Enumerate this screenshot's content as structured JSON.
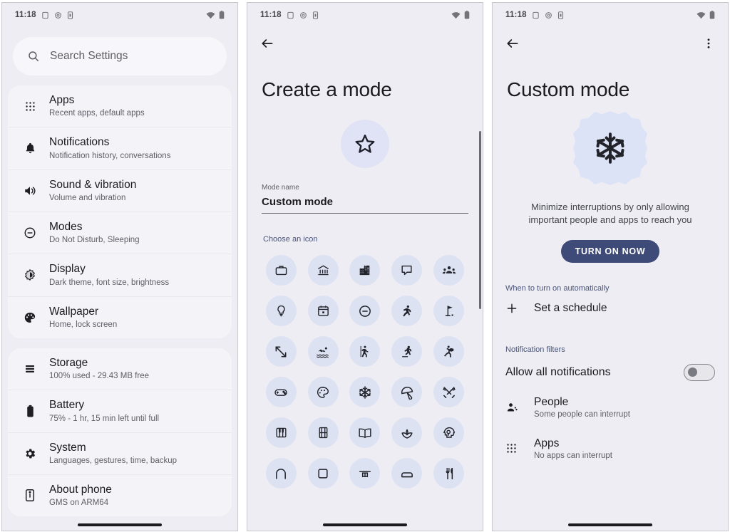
{
  "statusbar": {
    "time": "11:18",
    "left_icons": [
      "screenshot-icon",
      "gear-icon",
      "sim-card-icon"
    ],
    "right_icons": [
      "wifi-icon",
      "battery-icon"
    ]
  },
  "colors": {
    "screen_bg": "#eeedf3",
    "card_bg": "#f4f3f8",
    "search_bg": "#f7f6fa",
    "accent_chip": "#dde2f2",
    "accent_hero": "#dde3f6",
    "cta_bg": "#3e4a78",
    "section_label": "#4a5578",
    "primary_text": "#1b1b1f",
    "secondary_text": "#5e5e66"
  },
  "panel1": {
    "name": "settings-home",
    "search": {
      "placeholder": "Search Settings",
      "icon": "search-icon"
    },
    "groups": [
      {
        "items": [
          {
            "icon": "apps-grid-icon",
            "title": "Apps",
            "subtitle": "Recent apps, default apps"
          },
          {
            "icon": "bell-icon",
            "title": "Notifications",
            "subtitle": "Notification history, conversations"
          },
          {
            "icon": "volume-icon",
            "title": "Sound & vibration",
            "subtitle": "Volume and vibration"
          },
          {
            "icon": "do-not-disturb-icon",
            "title": "Modes",
            "subtitle": "Do Not Disturb, Sleeping"
          },
          {
            "icon": "brightness-icon",
            "title": "Display",
            "subtitle": "Dark theme, font size, brightness"
          },
          {
            "icon": "palette-icon",
            "title": "Wallpaper",
            "subtitle": "Home, lock screen"
          }
        ]
      },
      {
        "items": [
          {
            "icon": "storage-icon",
            "title": "Storage",
            "subtitle": "100% used - 29.43 MB free"
          },
          {
            "icon": "battery-icon",
            "title": "Battery",
            "subtitle": "75% - 1 hr, 15 min left until full"
          },
          {
            "icon": "gear-icon",
            "title": "System",
            "subtitle": "Languages, gestures, time, backup"
          },
          {
            "icon": "phone-info-icon",
            "title": "About phone",
            "subtitle": "GMS on ARM64"
          }
        ]
      }
    ]
  },
  "panel2": {
    "name": "create-a-mode",
    "back_icon": "back-arrow-icon",
    "title": "Create a mode",
    "badge_icon": "star-icon",
    "field": {
      "label": "Mode name",
      "value": "Custom mode"
    },
    "icon_picker": {
      "label": "Choose an icon",
      "icons": [
        "briefcase-icon",
        "bank-icon",
        "apartment-icon",
        "chat-bubble-icon",
        "groups-icon",
        "lightbulb-icon",
        "calendar-icon",
        "do-not-disturb-icon",
        "running-icon",
        "golf-icon",
        "arrows-diagonal-icon",
        "swimming-icon",
        "hiking-icon",
        "skating-icon",
        "martial-arts-icon",
        "gamepad-icon",
        "palette-icon",
        "snowflake-icon",
        "beach-umbrella-icon",
        "tools-icon",
        "piano-icon",
        "film-icon",
        "book-icon",
        "spa-icon",
        "psychology-icon",
        "arch-icon",
        "square-icon",
        "bench-icon",
        "bed-icon",
        "restaurant-icon"
      ]
    }
  },
  "panel3": {
    "name": "custom-mode-detail",
    "back_icon": "back-arrow-icon",
    "overflow_icon": "more-vert-icon",
    "title": "Custom mode",
    "hero_icon": "snowflake-icon",
    "description": "Minimize interruptions by only allowing important people and apps to reach you",
    "cta_label": "TURN ON NOW",
    "schedule_section": {
      "header": "When to turn on automatically",
      "add_icon": "plus-icon",
      "label": "Set a schedule"
    },
    "filters_section": {
      "header": "Notification filters",
      "toggle": {
        "label": "Allow all notifications",
        "state": "off"
      },
      "rows": [
        {
          "icon": "person-icon",
          "title": "People",
          "subtitle": "Some people can interrupt"
        },
        {
          "icon": "apps-grid-icon",
          "title": "Apps",
          "subtitle": "No apps can interrupt"
        }
      ]
    }
  }
}
